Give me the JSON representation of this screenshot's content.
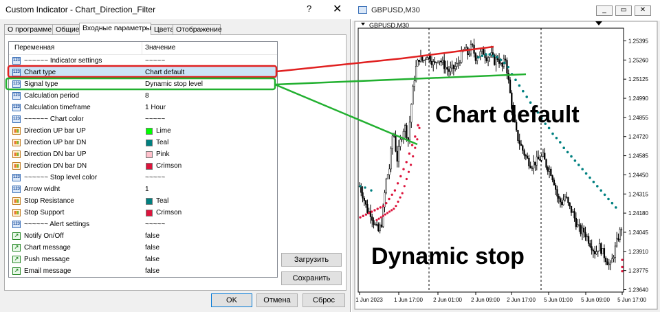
{
  "dialog": {
    "title": "Custom Indicator - Chart_Direction_Filter",
    "help_glyph": "?",
    "close_glyph": "✕",
    "tabs": [
      "О программе",
      "Общие",
      "Входные параметры",
      "Цвета",
      "Отображение"
    ],
    "active_tab": 2,
    "columns": {
      "name": "Переменная",
      "value": "Значение"
    },
    "params": [
      {
        "name": "~~~~~~ Indicator settings",
        "value": "~~~~~",
        "type": "text"
      },
      {
        "name": "Chart type",
        "value": "Chart default",
        "type": "text",
        "selected": true
      },
      {
        "name": "Signal type",
        "value": "Dynamic stop level",
        "type": "text"
      },
      {
        "name": "Calculation period",
        "value": "8",
        "type": "text"
      },
      {
        "name": "Calculation timeframe",
        "value": "1 Hour",
        "type": "text"
      },
      {
        "name": "~~~~~~ Chart color",
        "value": "~~~~~",
        "type": "text"
      },
      {
        "name": "Direction UP bar UP",
        "value": "Lime",
        "type": "color",
        "color": "#00ff00"
      },
      {
        "name": "Direction UP bar DN",
        "value": "Teal",
        "type": "color",
        "color": "#008080"
      },
      {
        "name": "Direction DN bar UP",
        "value": "Pink",
        "type": "color",
        "color": "#ffc0cb"
      },
      {
        "name": "Direction DN bar DN",
        "value": "Crimson",
        "type": "color",
        "color": "#dc143c"
      },
      {
        "name": "~~~~~~ Stop level color",
        "value": "~~~~~",
        "type": "text"
      },
      {
        "name": "Arrow widht",
        "value": "1",
        "type": "text"
      },
      {
        "name": "Stop Resistance",
        "value": "Teal",
        "type": "color",
        "color": "#008080"
      },
      {
        "name": "Stop Support",
        "value": "Crimson",
        "type": "color",
        "color": "#dc143c"
      },
      {
        "name": "~~~~~~ Alert settings",
        "value": "~~~~~",
        "type": "text"
      },
      {
        "name": "Notify On/Off",
        "value": "false",
        "type": "bool"
      },
      {
        "name": "Chart message",
        "value": "false",
        "type": "bool"
      },
      {
        "name": "Push message",
        "value": "false",
        "type": "bool"
      },
      {
        "name": "Email message",
        "value": "false",
        "type": "bool"
      }
    ],
    "buttons": {
      "load": "Загрузить",
      "save": "Сохранить",
      "ok": "OK",
      "cancel": "Отмена",
      "reset": "Сброс"
    }
  },
  "chart_window": {
    "title": "GBPUSD,M30",
    "symbol_label": "GBPUSD,M30",
    "win_buttons": [
      "_",
      "▭",
      "✕"
    ]
  },
  "chart_data": {
    "type": "candlestick",
    "symbol": "GBPUSD",
    "timeframe": "M30",
    "price_levels": [
      "1.25395",
      "1.25260",
      "1.25125",
      "1.24990",
      "1.24855",
      "1.24720",
      "1.24585",
      "1.24450",
      "1.24315",
      "1.24180",
      "1.24045",
      "1.23910",
      "1.23775",
      "1.23640"
    ],
    "ylim": [
      1.236,
      1.2545
    ],
    "time_labels": [
      "1 Jun 2023",
      "1 Jun 17:00",
      "2 Jun 01:00",
      "2 Jun 09:00",
      "2 Jun 17:00",
      "5 Jun 01:00",
      "5 Jun 09:00",
      "5 Jun 17:00"
    ],
    "close_path": [
      1.2437,
      1.243,
      1.242,
      1.2418,
      1.241,
      1.2405,
      1.2412,
      1.244,
      1.245,
      1.2478,
      1.2455,
      1.247,
      1.248,
      1.247,
      1.25,
      1.252,
      1.2528,
      1.2525,
      1.253,
      1.2527,
      1.2522,
      1.2528,
      1.2524,
      1.2521,
      1.2518,
      1.252,
      1.2522,
      1.2528,
      1.2534,
      1.253,
      1.2536,
      1.2528,
      1.253,
      1.2532,
      1.2528,
      1.253,
      1.2525,
      1.2528,
      1.252,
      1.2527,
      1.2507,
      1.2487,
      1.2473,
      1.2466,
      1.246,
      1.2455,
      1.2452,
      1.2454,
      1.2456,
      1.2458,
      1.2451,
      1.2448,
      1.244,
      1.2428,
      1.2425,
      1.243,
      1.2422,
      1.2418,
      1.241,
      1.2405,
      1.2405,
      1.24,
      1.2395,
      1.239,
      1.2395,
      1.239,
      1.2385,
      1.238,
      1.239,
      1.24,
      1.2408
    ],
    "stop_support": [
      1.2415,
      1.2416,
      1.2417,
      1.2418,
      1.2419,
      1.242,
      1.2421,
      1.2422,
      1.2423,
      1.2425,
      1.2428,
      1.2431,
      1.2434,
      1.2439,
      1.2444,
      1.2449,
      1.2454,
      1.246,
      1.2466,
      1.2472,
      1.248
    ],
    "stop_resistance": [
      1.2528,
      1.2529,
      1.253,
      1.253,
      1.2529,
      1.2528,
      1.2526,
      1.2524,
      1.2521,
      1.2516,
      1.2512,
      1.2508,
      1.2504,
      1.25,
      1.2496,
      1.2493,
      1.2489,
      1.2485,
      1.2481,
      1.2478,
      1.2474,
      1.2471,
      1.2468,
      1.2464,
      1.2461,
      1.2458,
      1.2455,
      1.2452,
      1.2449,
      1.2446,
      1.2443,
      1.244,
      1.2437,
      1.2434,
      1.2431,
      1.2428,
      1.2425,
      1.2422
    ],
    "late_support": [
      1.2385,
      1.238,
      1.2377
    ],
    "annotations": [
      "Chart default",
      "Dynamic stop"
    ]
  },
  "colors": {
    "highlight_red": "#e02020",
    "highlight_green": "#22b030",
    "stop_resistance": "#008080",
    "stop_support": "#dc143c",
    "candle": "#000000"
  }
}
